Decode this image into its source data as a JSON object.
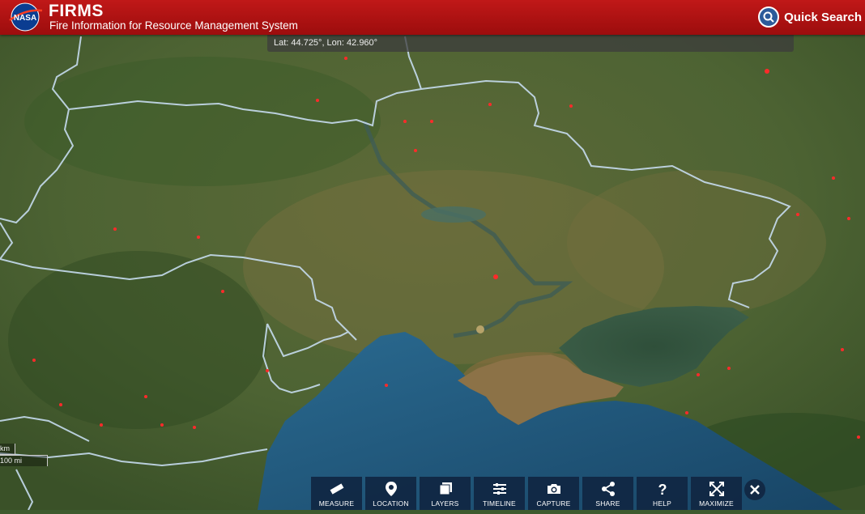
{
  "header": {
    "title": "FIRMS",
    "subtitle": "Fire Information for Resource Management System",
    "logo_text": "NASA",
    "quick_search_label": "Quick Search"
  },
  "coords": {
    "text": "Lat: 44.725°, Lon: 42.960°"
  },
  "scale": {
    "km_label": "km",
    "mi_label": "100 mi"
  },
  "toolbar": {
    "measure": "MEASURE",
    "location": "LOCATION",
    "layers": "LAYERS",
    "timeline": "TIMELINE",
    "capture": "CAPTURE",
    "share": "SHARE",
    "help": "HELP",
    "maximize": "MAXIMIZE"
  },
  "colors": {
    "header": "#b01212",
    "toolbar": "#102642",
    "sea": "#1d4e75",
    "border": "#c6dcef",
    "fire": "#ff2a2a"
  }
}
